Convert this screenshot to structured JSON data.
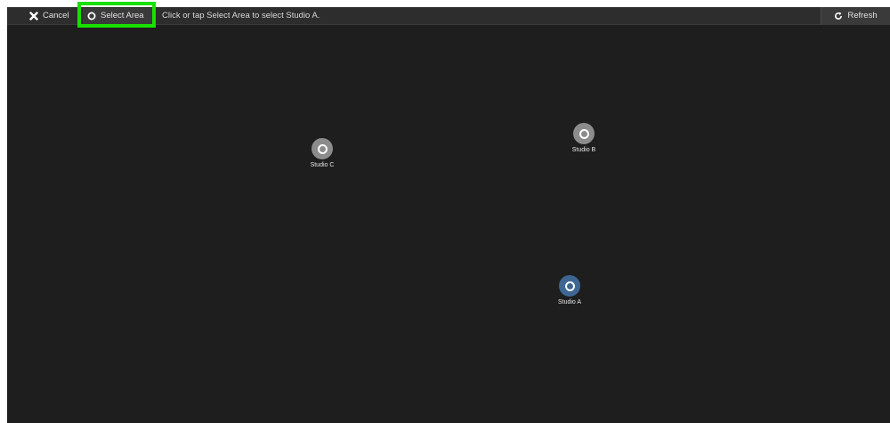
{
  "toolbar": {
    "cancel_label": "Cancel",
    "select_area_label": "Select Area",
    "instruction": "Click or tap Select Area to select Studio A.",
    "refresh_label": "Refresh"
  },
  "areas": [
    {
      "label": "Studio C",
      "state": "unselected",
      "color": "#8c8c8c"
    },
    {
      "label": "Studio B",
      "state": "unselected",
      "color": "#8c8c8c"
    },
    {
      "label": "Studio A",
      "state": "selected",
      "color": "#3d6792"
    }
  ],
  "colors": {
    "background": "#1e1e1e",
    "toolbar": "#2d2d2d",
    "highlight": "#19e000"
  }
}
